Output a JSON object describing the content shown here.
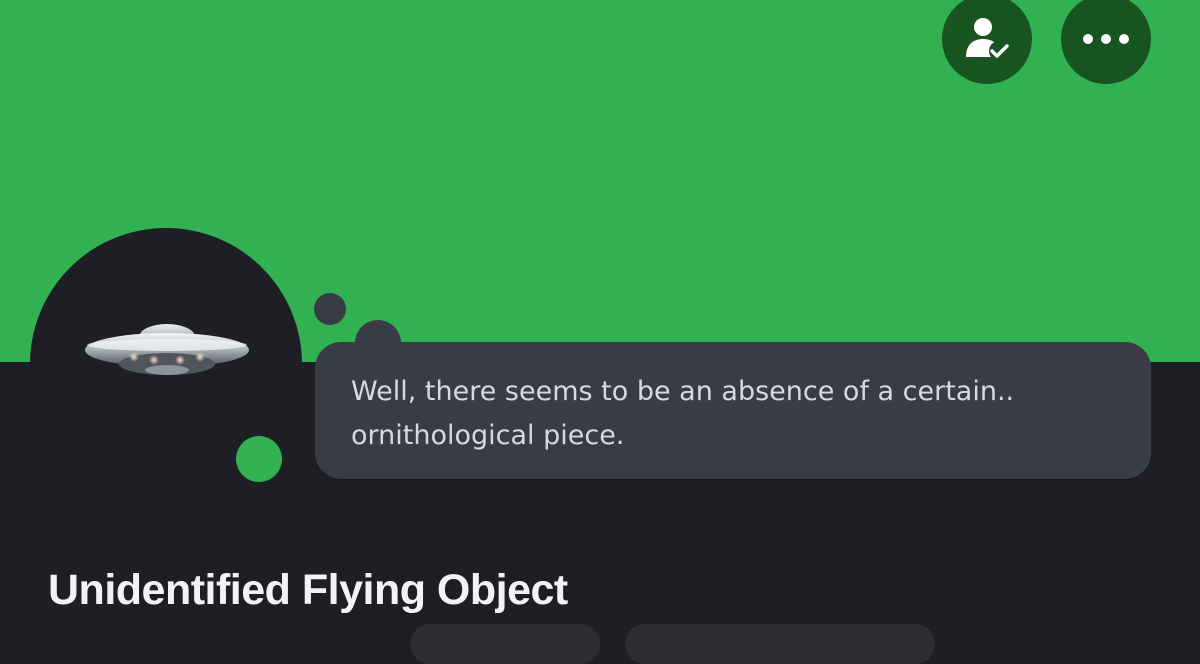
{
  "header": {
    "banner_color": "#31b152",
    "actions": [
      {
        "icon": "friend-check-icon",
        "label": "Friends"
      },
      {
        "icon": "more-dots-icon",
        "label": "More"
      }
    ]
  },
  "profile": {
    "avatar": "ufo-avatar",
    "status": "online",
    "status_color": "#31b152",
    "custom_status": "Well, there seems to be an absence of a certain.. ornithological piece.",
    "display_name": "Unidentified Flying Object"
  }
}
